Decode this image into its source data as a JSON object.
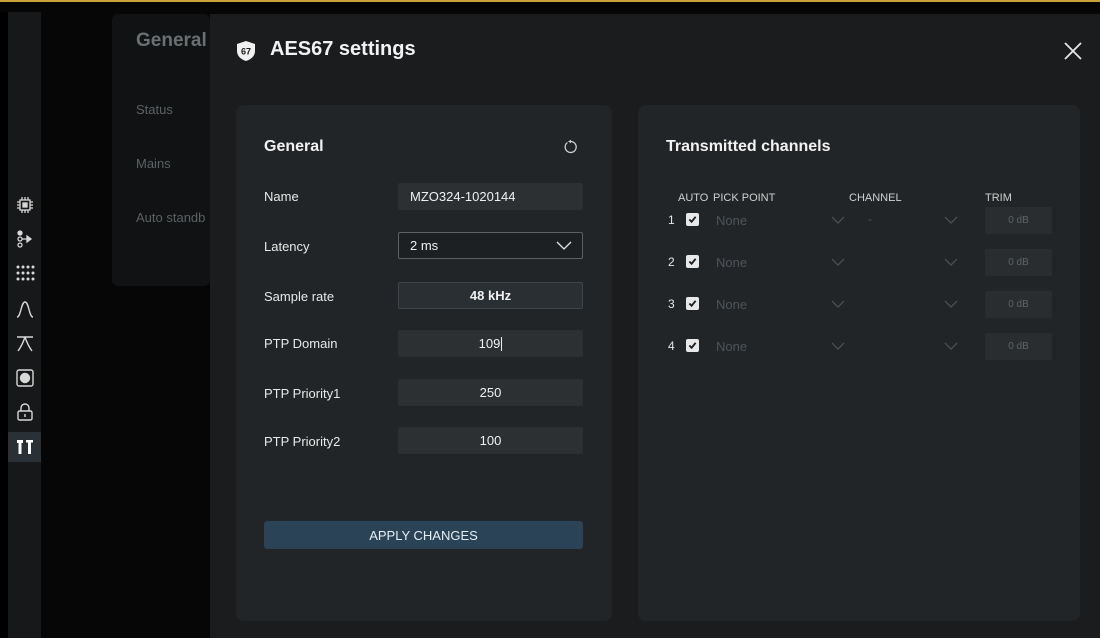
{
  "background": {
    "title": "General",
    "items": [
      "Status",
      "Mains",
      "Auto standb"
    ]
  },
  "rail": {
    "icons": [
      "chip-icon",
      "routing-icon",
      "grid-icon",
      "curve-icon",
      "filter-icon",
      "speaker-icon",
      "lock-icon",
      "tools-icon"
    ],
    "active": "tools-icon"
  },
  "modal": {
    "title": "AES67 settings",
    "logo_text": "67"
  },
  "general": {
    "title": "General",
    "fields": {
      "name": {
        "label": "Name",
        "value": "MZO324-1020144"
      },
      "latency": {
        "label": "Latency",
        "value": "2 ms"
      },
      "sample_rate": {
        "label": "Sample rate",
        "value": "48 kHz"
      },
      "ptp_domain": {
        "label": "PTP Domain",
        "value": "109"
      },
      "ptp_priority1": {
        "label": "PTP Priority1",
        "value": "250"
      },
      "ptp_priority2": {
        "label": "PTP Priority2",
        "value": "100"
      }
    },
    "apply_label": "APPLY CHANGES"
  },
  "transmitted": {
    "title": "Transmitted channels",
    "headers": {
      "auto": "AUTO",
      "pick_point": "PICK POINT",
      "channel": "CHANNEL",
      "trim": "TRIM"
    },
    "rows": [
      {
        "num": "1",
        "auto": true,
        "pick_point": "None",
        "channel": "-",
        "trim": "0 dB"
      },
      {
        "num": "2",
        "auto": true,
        "pick_point": "None",
        "channel": "",
        "trim": "0 dB"
      },
      {
        "num": "3",
        "auto": true,
        "pick_point": "None",
        "channel": "",
        "trim": "0 dB"
      },
      {
        "num": "4",
        "auto": true,
        "pick_point": "None",
        "channel": "",
        "trim": "0 dB"
      }
    ]
  },
  "colors": {
    "accent_border": "#c8a23a",
    "apply_button": "#2b4356",
    "card": "#222527",
    "modal": "#1a1c1d"
  }
}
